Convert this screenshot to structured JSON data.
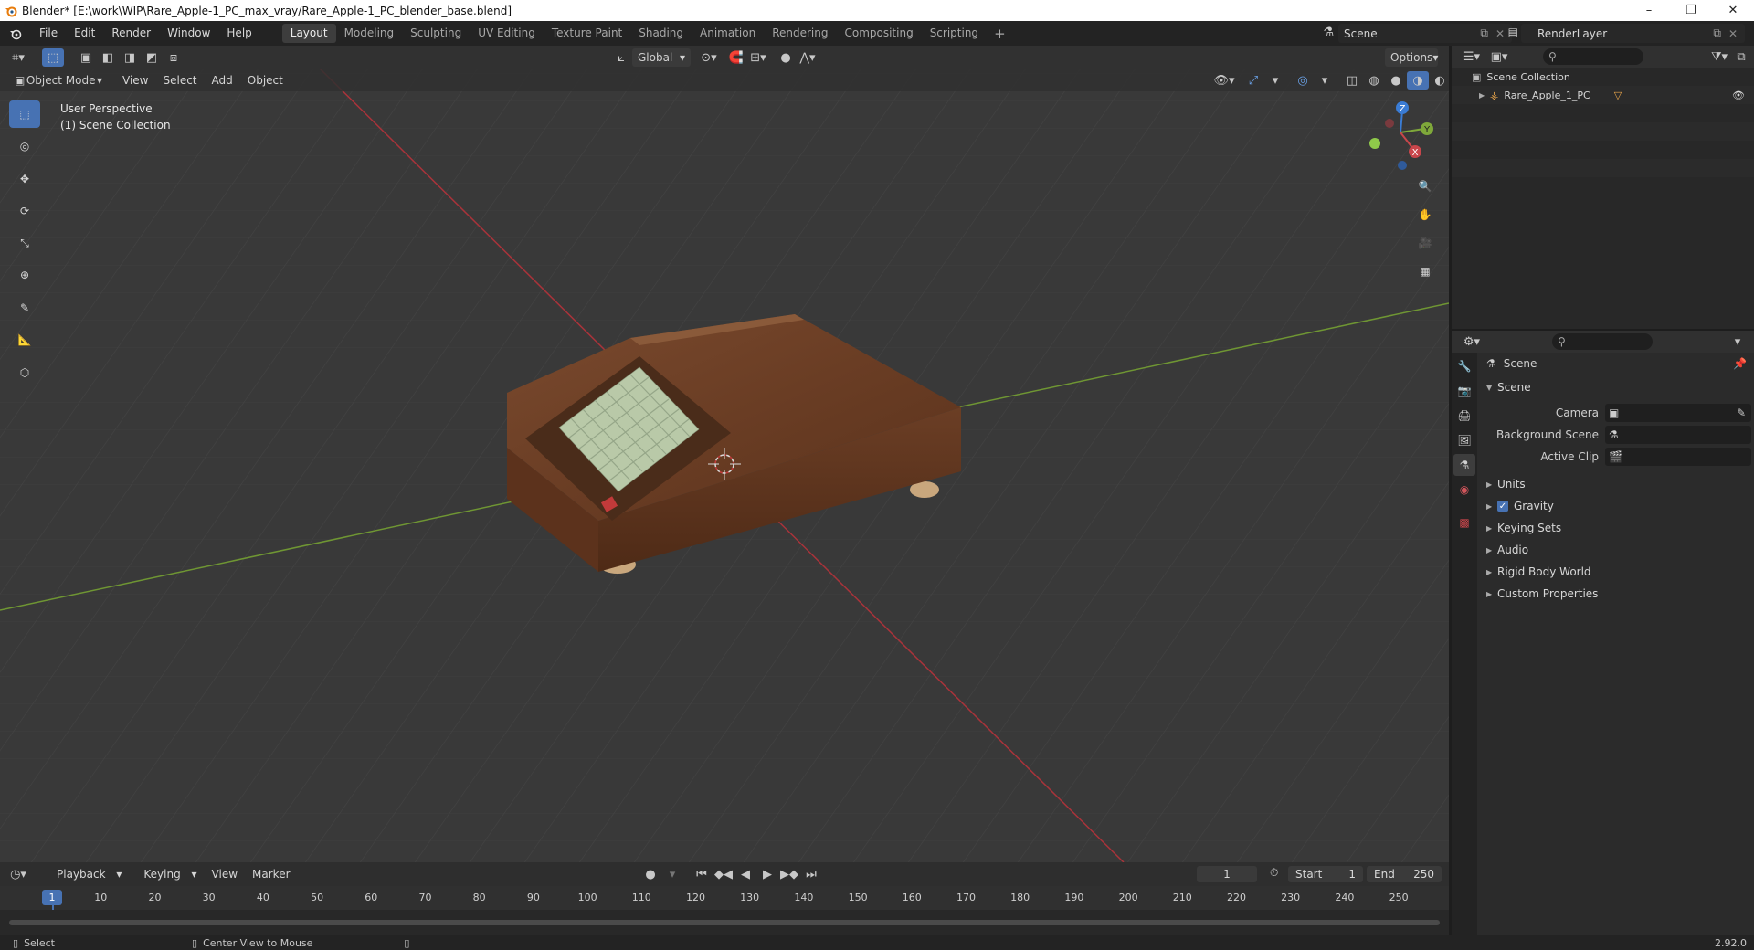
{
  "window": {
    "title": "Blender* [E:\\work\\WIP\\Rare_Apple-1_PC_max_vray/Rare_Apple-1_PC_blender_base.blend]",
    "controls": [
      "–",
      "❐",
      "✕"
    ]
  },
  "menu": [
    "File",
    "Edit",
    "Render",
    "Window",
    "Help"
  ],
  "workspaces": [
    {
      "label": "Layout",
      "active": true
    },
    {
      "label": "Modeling"
    },
    {
      "label": "Sculpting"
    },
    {
      "label": "UV Editing"
    },
    {
      "label": "Texture Paint"
    },
    {
      "label": "Shading"
    },
    {
      "label": "Animation"
    },
    {
      "label": "Rendering"
    },
    {
      "label": "Compositing"
    },
    {
      "label": "Scripting"
    }
  ],
  "scene_field": "Scene",
  "render_layer_field": "RenderLayer",
  "viewport": {
    "transform_orientation": "Global",
    "options_label": "Options",
    "mode": "Object Mode",
    "menus": [
      "View",
      "Select",
      "Add",
      "Object"
    ],
    "overlay_line1": "User Perspective",
    "overlay_line2": "(1) Scene Collection",
    "gizmo": {
      "z": "Z",
      "y": "Y",
      "x": "X"
    }
  },
  "timeline": {
    "menus": [
      "Playback",
      "Keying",
      "View",
      "Marker"
    ],
    "current_frame": "1",
    "start_label": "Start",
    "start_value": "1",
    "end_label": "End",
    "end_value": "250",
    "ruler": [
      "10",
      "20",
      "30",
      "40",
      "50",
      "60",
      "70",
      "80",
      "90",
      "100",
      "110",
      "120",
      "130",
      "140",
      "150",
      "160",
      "170",
      "180",
      "190",
      "200",
      "210",
      "220",
      "230",
      "240",
      "250"
    ],
    "cursor_label": "1"
  },
  "status": {
    "left": "Select",
    "middle": "Center View to Mouse",
    "version": "2.92.0"
  },
  "outliner": {
    "collection": "Scene Collection",
    "object": "Rare_Apple_1_PC"
  },
  "properties": {
    "context": "Scene",
    "panel": "Scene",
    "fields": [
      {
        "label": "Camera"
      },
      {
        "label": "Background Scene"
      },
      {
        "label": "Active Clip"
      }
    ],
    "subpanels": [
      {
        "label": "Units",
        "checkbox": false
      },
      {
        "label": "Gravity",
        "checkbox": true
      },
      {
        "label": "Keying Sets",
        "checkbox": false
      },
      {
        "label": "Audio",
        "checkbox": false
      },
      {
        "label": "Rigid Body World",
        "checkbox": false
      },
      {
        "label": "Custom Properties",
        "checkbox": false
      }
    ]
  },
  "colors": {
    "accent": "#4772b3",
    "x_axis": "#c8464b",
    "y_axis": "#7fa83a",
    "z_axis": "#3a7cd5"
  }
}
